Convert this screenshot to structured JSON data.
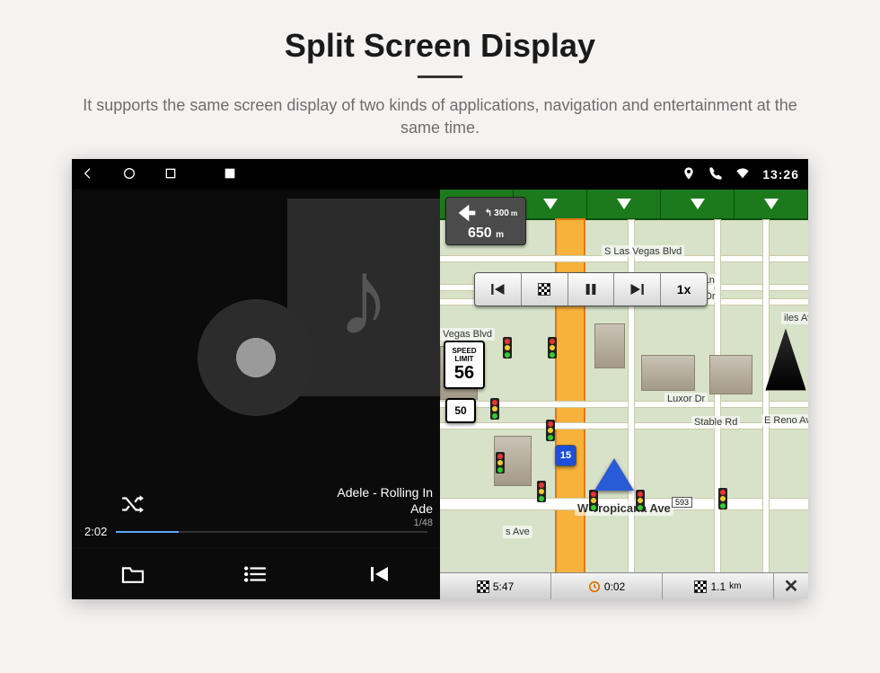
{
  "page": {
    "title": "Split Screen Display",
    "description": "It supports the same screen display of two kinds of applications, navigation and entertainment at the same time."
  },
  "statusbar": {
    "time": "13:26"
  },
  "music": {
    "track_title": "Adele - Rolling In",
    "artist": "Ade",
    "track_index": "1/48",
    "elapsed": "2:02"
  },
  "nav": {
    "turn_next_dist": "300",
    "turn_next_unit": "m",
    "turn_total_dist": "650",
    "turn_total_unit": "m",
    "speed_label_1": "SPEED",
    "speed_label_2": "LIMIT",
    "speed_value": "56",
    "route_shield": "50",
    "playback_speed": "1x",
    "streets": {
      "s_las_vegas": "S Las Vegas Blvd",
      "koval": "Koval Ln",
      "duke": "Duke Ellington Dr",
      "vegas_blvd": "Vegas Blvd",
      "tiles": "iles Ave",
      "luxor": "Luxor Dr",
      "stable": "Stable Rd",
      "reno": "E Reno Ave",
      "tropicana": "W Tropicana Ave",
      "s_ave": "s Ave",
      "i15": "15"
    },
    "badge_593": "593",
    "bottom": {
      "arrival": "5:47",
      "time_left": "0:02",
      "dist_left_val": "1.1",
      "dist_left_unit": "km"
    }
  }
}
